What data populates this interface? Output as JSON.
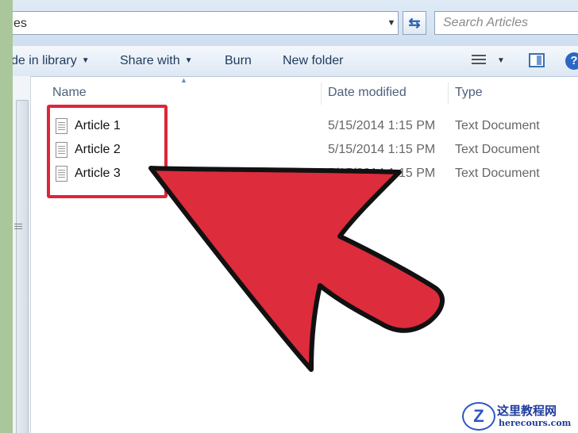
{
  "address": {
    "value": "es"
  },
  "search": {
    "placeholder": "Search Articles"
  },
  "toolbar": {
    "include_in_library": "de in library",
    "share_with": "Share with",
    "burn": "Burn",
    "new_folder": "New folder"
  },
  "columns": {
    "name": "Name",
    "date_modified": "Date modified",
    "type": "Type"
  },
  "files": [
    {
      "name": "Article 1",
      "date": "5/15/2014 1:15 PM",
      "type": "Text Document"
    },
    {
      "name": "Article 2",
      "date": "5/15/2014 1:15 PM",
      "type": "Text Document"
    },
    {
      "name": "Article 3",
      "date": "5/15/2014 1:15 PM",
      "type": "Text Document"
    }
  ],
  "watermark": {
    "title": "这里教程网",
    "subtitle": "herecours.com",
    "logo_letter": "Z"
  },
  "icons": {
    "refresh": "refresh-icon",
    "view": "view-options-icon",
    "preview": "preview-pane-icon",
    "help": "help-icon",
    "file": "text-file-icon"
  },
  "colors": {
    "highlight": "#dd2638",
    "arrow": "#dd2c3c",
    "accent": "#2b68c5"
  }
}
